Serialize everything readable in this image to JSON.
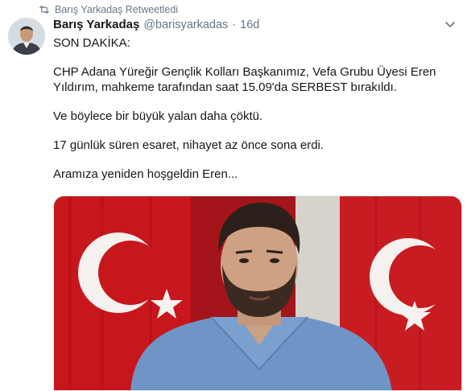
{
  "retweet": {
    "icon": "retweet-icon",
    "text": "Barış Yarkadaş Retweetledi"
  },
  "tweet": {
    "author_name": "Barış Yarkadaş",
    "author_handle": "@barisyarkadas",
    "separator": "·",
    "age": "16d",
    "lines": [
      "SON DAKİKA:",
      "CHP Adana Yüreğir Gençlik Kolları Başkanımız, Vefa Grubu Üyesi Eren",
      "Yıldırım, mahkeme tarafından saat 15.09'da SERBEST bırakıldı.",
      "Ve böylece bir büyük yalan daha çöktü.",
      "17 günlük süren esaret, nihayet az önce sona erdi.",
      "Aramıza yeniden hoşgeldin Eren..."
    ]
  },
  "colors": {
    "text": "#14171a",
    "muted": "#657786",
    "flag_red": "#c8161d"
  }
}
